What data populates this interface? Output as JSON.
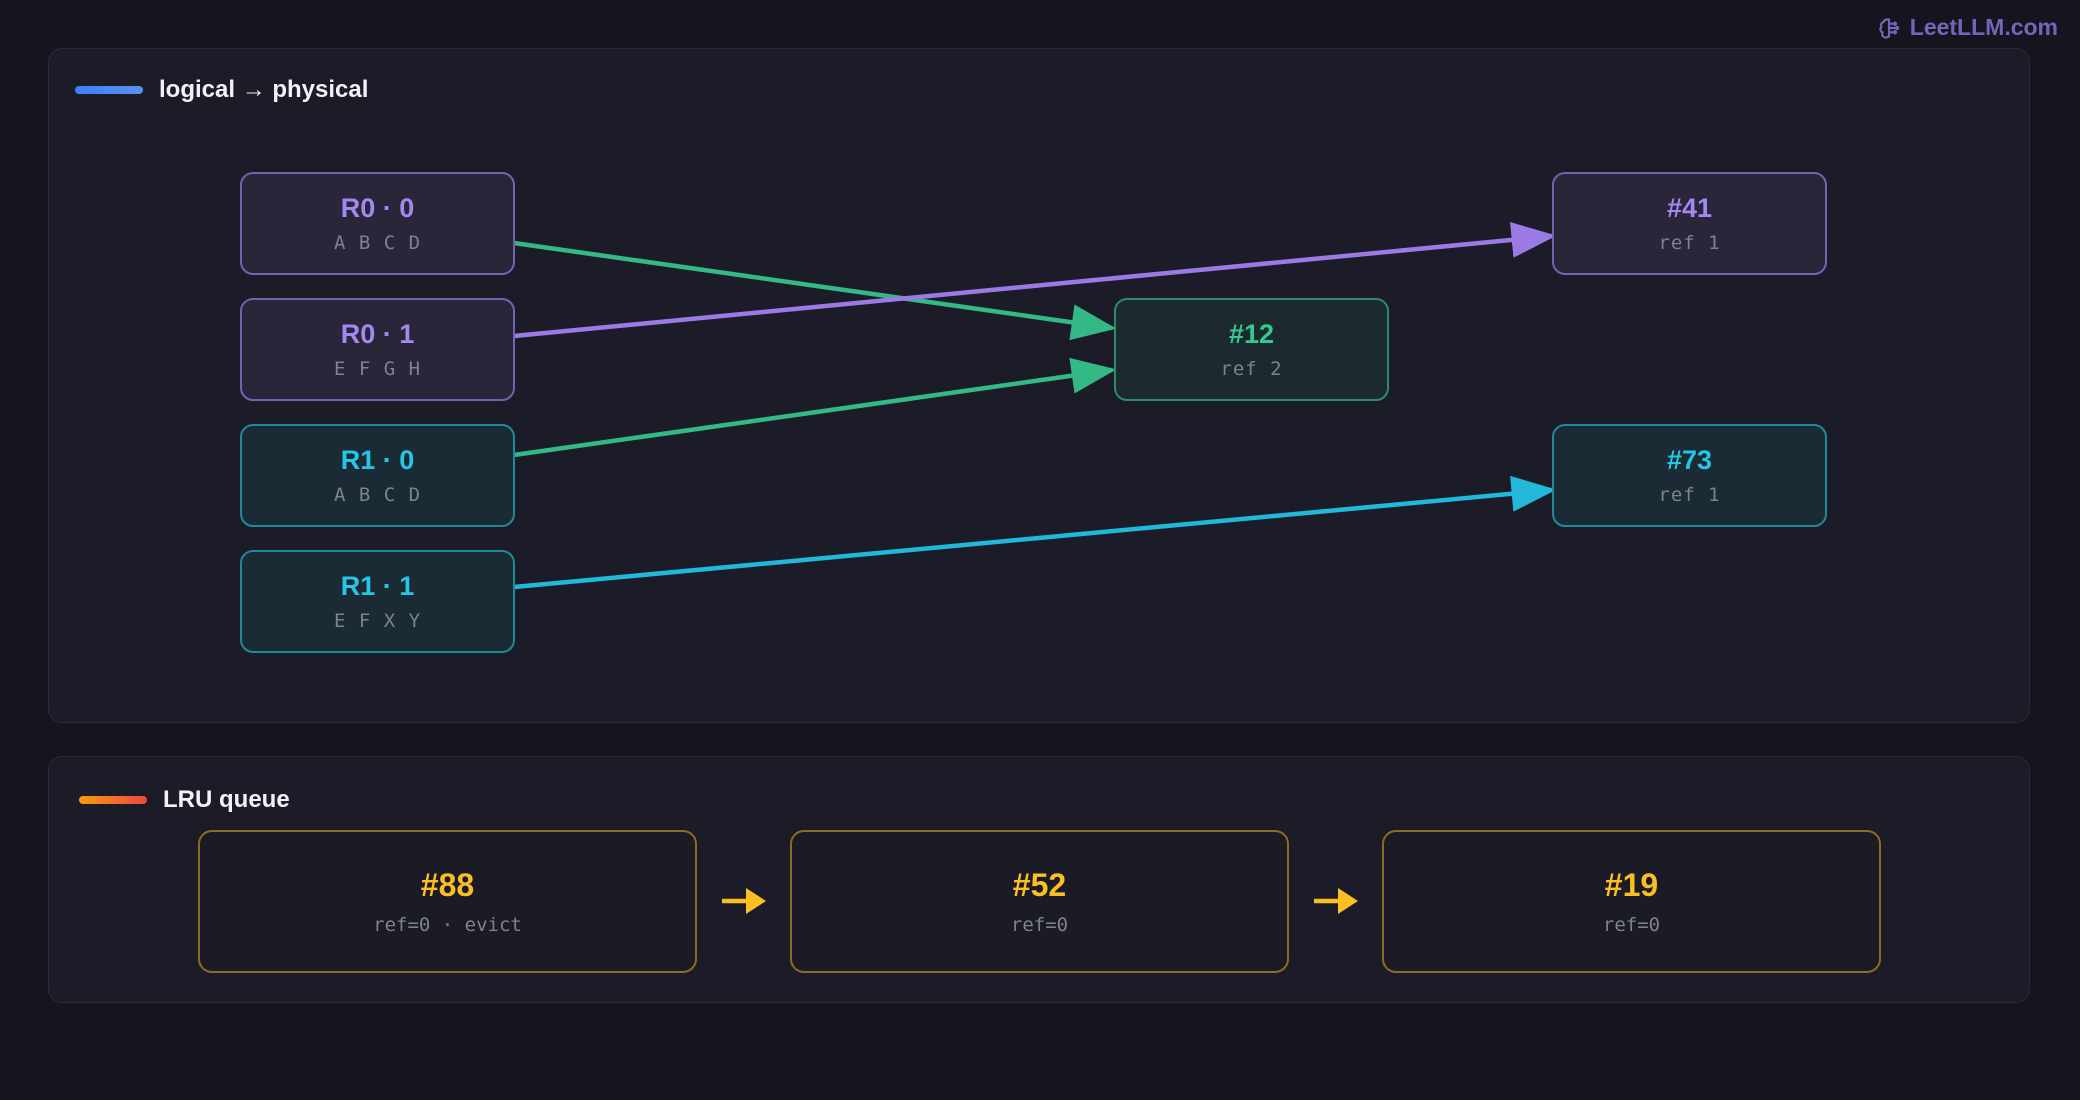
{
  "brand": {
    "text": "LeetLLM.com",
    "color": "#7565b8"
  },
  "mapping_panel": {
    "title": "logical → physical",
    "logical_blocks": [
      {
        "id": "R0 · 0",
        "tokens": "A B C D",
        "color": "#a487f0"
      },
      {
        "id": "R0 · 1",
        "tokens": "E F G H",
        "color": "#a487f0"
      },
      {
        "id": "R1 · 0",
        "tokens": "A B C D",
        "color": "#26c6e6"
      },
      {
        "id": "R1 · 1",
        "tokens": "E F X Y",
        "color": "#26c6e6"
      }
    ],
    "physical_blocks": [
      {
        "id": "#41",
        "ref": "ref 1",
        "color": "#a487f0"
      },
      {
        "id": "#12",
        "ref": "ref 2",
        "color": "#34c992"
      },
      {
        "id": "#73",
        "ref": "ref 1",
        "color": "#26c6e6"
      }
    ],
    "edges": [
      {
        "from": "R0 · 0",
        "to": "#12",
        "color": "#34b886"
      },
      {
        "from": "R0 · 1",
        "to": "#41",
        "color": "#9b7ae6"
      },
      {
        "from": "R1 · 0",
        "to": "#12",
        "color": "#34b886"
      },
      {
        "from": "R1 · 1",
        "to": "#73",
        "color": "#22b8d9"
      }
    ]
  },
  "lru_panel": {
    "title": "LRU queue",
    "items": [
      {
        "id": "#88",
        "status": "ref=0 · evict"
      },
      {
        "id": "#52",
        "status": "ref=0"
      },
      {
        "id": "#19",
        "status": "ref=0"
      }
    ],
    "accent": "#fbbf24"
  }
}
